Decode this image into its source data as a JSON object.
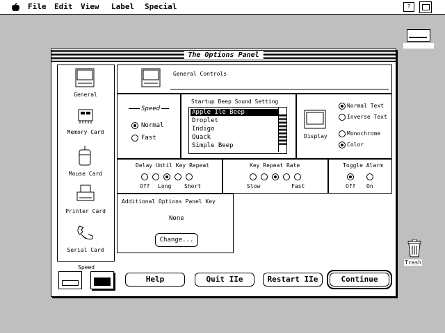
{
  "menubar": {
    "items": [
      "File",
      "Edit",
      "View",
      "Label",
      "Special"
    ]
  },
  "desktop": {
    "disk_label": "",
    "trash_label": "Trash"
  },
  "window": {
    "title": "The Options Panel"
  },
  "sidebar": {
    "items": [
      {
        "label": "General",
        "icon": "general-icon"
      },
      {
        "label": "Memory Card",
        "icon": "memory-card-icon"
      },
      {
        "label": "Mouse Card",
        "icon": "mouse-icon"
      },
      {
        "label": "Printer Card",
        "icon": "printer-icon"
      },
      {
        "label": "Serial Card",
        "icon": "serial-card-icon"
      }
    ]
  },
  "header": {
    "section_title": "General Controls"
  },
  "speed": {
    "title": "Speed",
    "options": [
      "Normal",
      "Fast"
    ],
    "selected": "Normal"
  },
  "startup_sound": {
    "title": "Startup Beep Sound Setting",
    "items": [
      "Apple Ile Beep",
      "Droplet",
      "Indigo",
      "Quack",
      "Simple Beep"
    ],
    "selected": "Apple Ile Beep"
  },
  "display": {
    "icon_label": "Display",
    "options_a": [
      "Normal Text",
      "Inverse Text"
    ],
    "selected_a": "Normal Text",
    "options_b": [
      "Monochrome",
      "Color"
    ],
    "selected_b": "Color"
  },
  "delay": {
    "title": "Delay Until Key Repeat",
    "left": "Off",
    "mid": "Long",
    "right": "Short",
    "selected_index": 2
  },
  "repeat": {
    "title": "Key Repeat Rate",
    "left": "Slow",
    "right": "Fast",
    "selected_index": 2
  },
  "toggle": {
    "title": "Toggle Alarm",
    "options": [
      "Off",
      "On"
    ],
    "selected": "Off"
  },
  "panel_key": {
    "title": "Additional Options Panel Key",
    "value": "None",
    "button": "Change..."
  },
  "footer": {
    "speed_label": "Speed",
    "buttons": {
      "help": "Help",
      "quit": "Quit IIe",
      "restart": "Restart IIe",
      "continue": "Continue"
    }
  }
}
